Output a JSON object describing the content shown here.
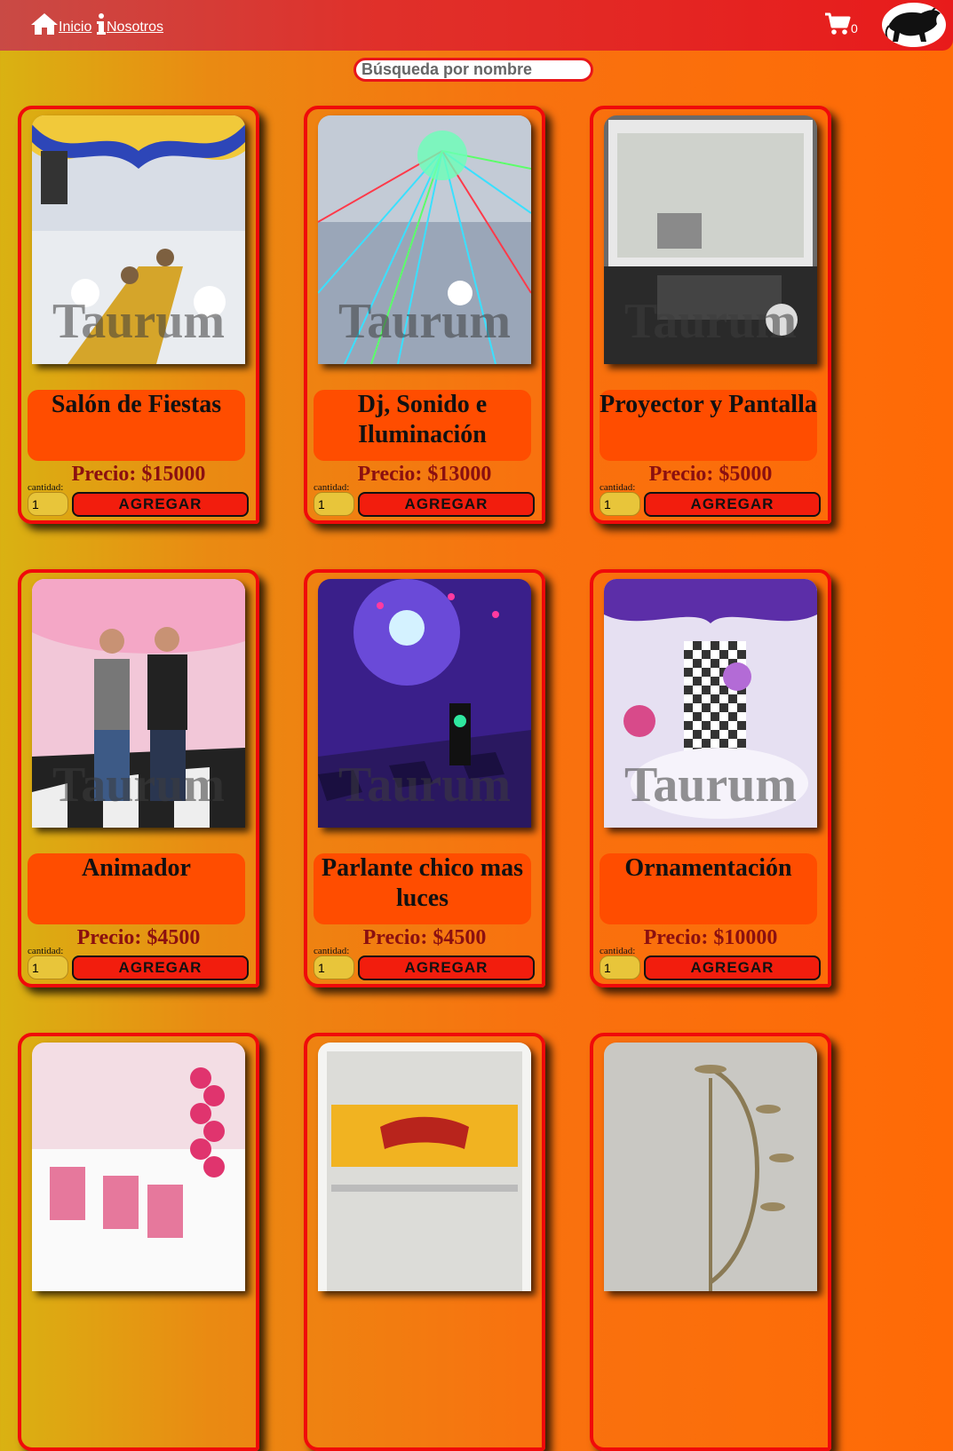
{
  "nav": {
    "home_label": "Inicio",
    "about_label": "Nosotros",
    "cart_count": "0"
  },
  "search": {
    "placeholder": "Búsqueda por nombre"
  },
  "watermark": "Taurum",
  "qty_label": "cantidad:",
  "qty_default": "1",
  "add_label": "AGREGAR",
  "products": [
    {
      "title": "Salón de Fiestas",
      "price": "Precio: $15000"
    },
    {
      "title": "Dj, Sonido e Iluminación",
      "price": "Precio: $13000"
    },
    {
      "title": "Proyector y Pantalla",
      "price": "Precio: $5000"
    },
    {
      "title": "Animador",
      "price": "Precio: $4500"
    },
    {
      "title": "Parlante chico mas luces",
      "price": "Precio: $4500"
    },
    {
      "title": "Ornamentación",
      "price": "Precio: $10000"
    }
  ],
  "colors": {
    "accent": "#f00a0a",
    "title_bg": "#ff4d00",
    "price": "#8b1010",
    "qty_bg": "#e8c53a"
  }
}
